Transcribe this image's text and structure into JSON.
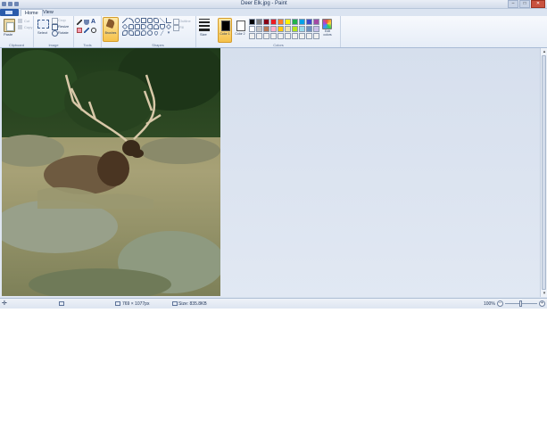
{
  "window": {
    "title": "Deer Elk.jpg - Paint",
    "controls": [
      "minimize",
      "maximize",
      "close"
    ]
  },
  "quick_access": [
    "save-icon",
    "undo-icon",
    "redo-icon"
  ],
  "tabs": [
    {
      "label": "Home",
      "active": true
    },
    {
      "label": "View",
      "active": false
    }
  ],
  "ribbon": {
    "clipboard": {
      "group_label": "Clipboard",
      "paste_label": "Paste",
      "cut_label": "Cut",
      "copy_label": "Copy"
    },
    "image": {
      "group_label": "Image",
      "select_label": "Select",
      "crop_label": "Crop",
      "resize_label": "Resize",
      "rotate_label": "Rotate"
    },
    "tools": {
      "group_label": "Tools",
      "items": [
        "pencil-icon",
        "fill-icon",
        "text-icon",
        "eraser-icon",
        "color-picker-icon",
        "magnifier-icon"
      ]
    },
    "brushes": {
      "label": "Brushes"
    },
    "shapes": {
      "group_label": "Shapes",
      "outline_label": "Outline",
      "fill_label": "Fill"
    },
    "size": {
      "label": "Size"
    },
    "colors": {
      "group_label": "Colors",
      "color1_label": "Color 1",
      "color2_label": "Color 2",
      "edit_colors_label": "Edit colors",
      "color1_value": "#000000",
      "color2_value": "#ffffff",
      "palette": [
        "#000000",
        "#7f7f7f",
        "#880015",
        "#ed1c24",
        "#ff7f27",
        "#fff200",
        "#22b14c",
        "#00a2e8",
        "#3f48cc",
        "#a349a4",
        "#ffffff",
        "#c3c3c3",
        "#b97a57",
        "#ffaec9",
        "#ffc90e",
        "#efe4b0",
        "#b5e61d",
        "#99d9ea",
        "#7092be",
        "#c8bfe7",
        "#f0f0f0",
        "#f0f0f0",
        "#f0f0f0",
        "#f0f0f0",
        "#f0f0f0",
        "#f0f0f0",
        "#f0f0f0",
        "#f0f0f0",
        "#f0f0f0",
        "#f0f0f0"
      ]
    }
  },
  "status": {
    "dimensions": "769 × 1077px",
    "size": "Size: 835.8KB",
    "zoom": "100%"
  }
}
